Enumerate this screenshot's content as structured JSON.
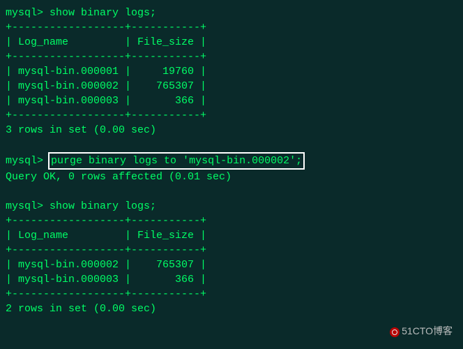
{
  "prompt": "mysql>",
  "cmd_show": "show binary logs;",
  "cmd_purge": "purge binary logs to 'mysql-bin.000002';",
  "table_sep": "+------------------+-----------+",
  "header_row": "| Log_name         | File_size |",
  "table1": {
    "rows": [
      "| mysql-bin.000001 |     19760 |",
      "| mysql-bin.000002 |    765307 |",
      "| mysql-bin.000003 |       366 |"
    ],
    "summary": "3 rows in set (0.00 sec)"
  },
  "purge_result": "Query OK, 0 rows affected (0.01 sec)",
  "table2": {
    "rows": [
      "| mysql-bin.000002 |    765307 |",
      "| mysql-bin.000003 |       366 |"
    ],
    "summary": "2 rows in set (0.00 sec)"
  },
  "watermark": "51CTO博客",
  "chart_data": {
    "type": "table",
    "title": "MySQL binary logs before and after purge",
    "before": {
      "columns": [
        "Log_name",
        "File_size"
      ],
      "rows": [
        [
          "mysql-bin.000001",
          19760
        ],
        [
          "mysql-bin.000002",
          765307
        ],
        [
          "mysql-bin.000003",
          366
        ]
      ],
      "row_count": 3,
      "elapsed_sec": 0.0
    },
    "purge_command": "purge binary logs to 'mysql-bin.000002';",
    "purge_result": {
      "rows_affected": 0,
      "elapsed_sec": 0.01
    },
    "after": {
      "columns": [
        "Log_name",
        "File_size"
      ],
      "rows": [
        [
          "mysql-bin.000002",
          765307
        ],
        [
          "mysql-bin.000003",
          366
        ]
      ],
      "row_count": 2,
      "elapsed_sec": 0.0
    }
  }
}
